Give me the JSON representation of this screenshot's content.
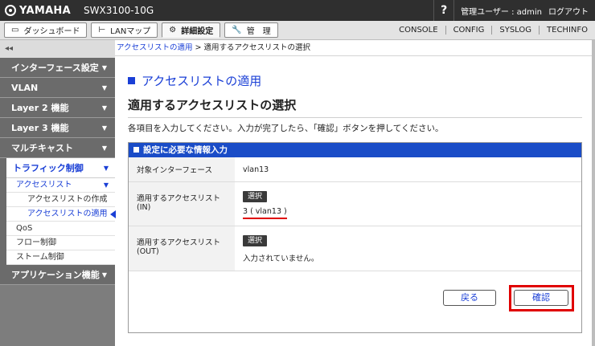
{
  "header": {
    "brand": "YAMAHA",
    "model": "SWX3100-10G",
    "help": "?",
    "user": "管理ユーザー : admin",
    "logout": "ログアウト"
  },
  "nav": {
    "dashboard": "ダッシュボード",
    "lanmap": "LANマップ",
    "detail": "詳細設定",
    "admin": "管　理",
    "links": [
      "CONSOLE",
      "CONFIG",
      "SYSLOG",
      "TECHINFO"
    ]
  },
  "sidebar": {
    "collapse": "◂◂",
    "items": [
      {
        "label": "インターフェース設定"
      },
      {
        "label": "VLAN"
      },
      {
        "label": "Layer 2 機能"
      },
      {
        "label": "Layer 3 機能"
      },
      {
        "label": "マルチキャスト"
      }
    ],
    "open": {
      "label": "トラフィック制御",
      "acl": "アクセスリスト",
      "acl_create": "アクセスリストの作成",
      "acl_apply": "アクセスリストの適用",
      "qos": "QoS",
      "flow": "フロー制御",
      "storm": "ストーム制御"
    },
    "app": "アプリケーション機能"
  },
  "breadcrumb": {
    "link": "アクセスリストの適用",
    "sep": " > ",
    "current": "適用するアクセスリストの選択"
  },
  "main": {
    "title": "アクセスリストの適用",
    "subtitle": "適用するアクセスリストの選択",
    "instruction": "各項目を入力してください。入力が完了したら、「確認」ボタンを押してください。",
    "panel_title": "設定に必要な情報入力",
    "rows": [
      {
        "label": "対象インターフェース",
        "value": "vlan13"
      },
      {
        "label": "適用するアクセスリスト (IN)",
        "button": "選択",
        "value": "3 ( vlan13 )"
      },
      {
        "label": "適用するアクセスリスト (OUT)",
        "button": "選択",
        "value": "入力されていません。"
      }
    ],
    "back": "戻る",
    "confirm": "確認"
  }
}
